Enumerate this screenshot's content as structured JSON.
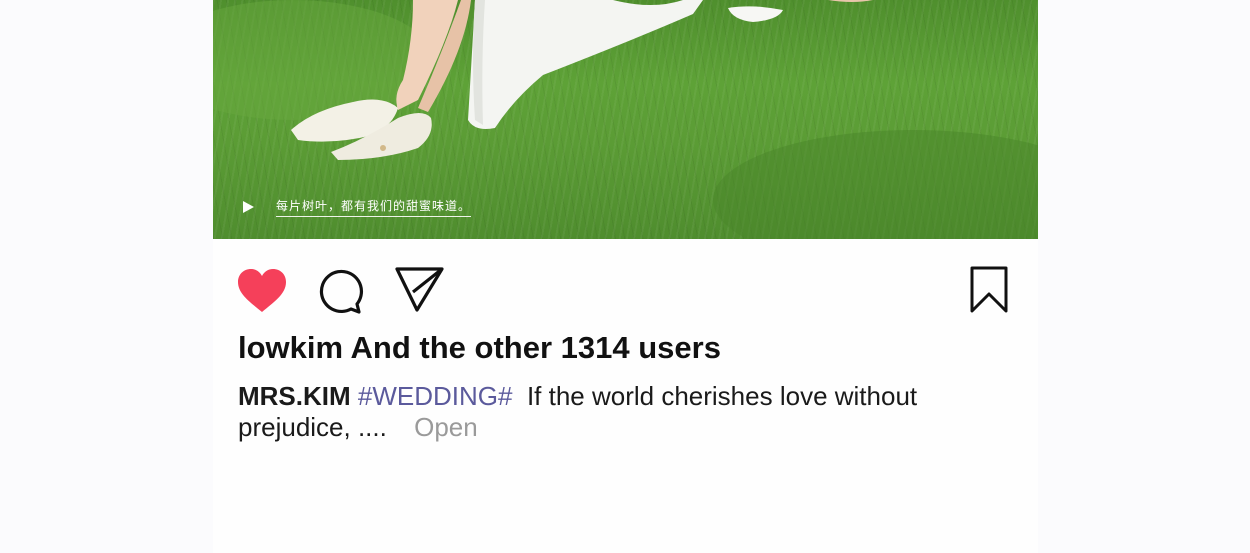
{
  "photo": {
    "overlay_text": "每片树叶，都有我们的甜蜜味道。",
    "play_icon": "play-icon"
  },
  "actions": {
    "like": "heart-filled-icon",
    "comment": "comment-bubble-icon",
    "share": "send-icon",
    "save": "bookmark-icon",
    "like_color": "#f5405a"
  },
  "likes_text": "lowkim And the other 1314 users",
  "caption": {
    "author": "MRS.KIM",
    "hashtag": "#WEDDING#",
    "text": "If the world cherishes love without prejudice, ....",
    "more": "Open"
  },
  "colors": {
    "hashtag": "#5b5a9c",
    "more": "#9a9a9a"
  }
}
